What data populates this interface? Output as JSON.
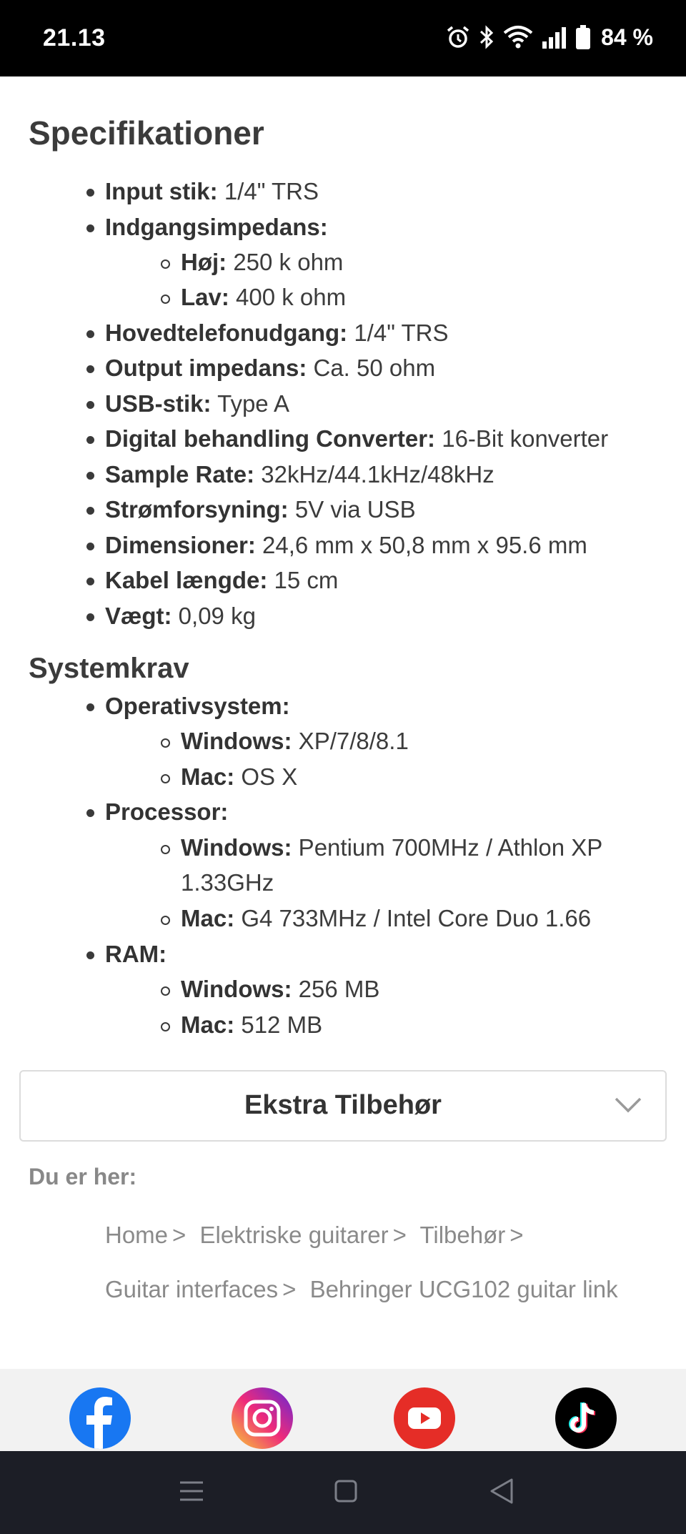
{
  "status_bar": {
    "time": "21.13",
    "battery_percent": "84 %",
    "icons": [
      "alarm-icon",
      "bluetooth-icon",
      "wifi-icon",
      "signal-icon",
      "battery-icon"
    ]
  },
  "specs": {
    "title": "Specifikationer",
    "items": [
      {
        "label": "Input stik:",
        "value": " 1/4\" TRS"
      },
      {
        "label": "Indgangsimpedans:",
        "value": ""
      },
      {
        "label": "Høj:",
        "value": " 250 k ohm"
      },
      {
        "label": "Lav:",
        "value": " 400 k ohm"
      },
      {
        "label": "Hovedtelefonudgang:",
        "value": " 1/4\" TRS"
      },
      {
        "label": "Output impedans:",
        "value": " Ca. 50 ohm"
      },
      {
        "label": "USB-stik:",
        "value": " Type A"
      },
      {
        "label": "Digital behandling Converter:",
        "value": " 16-Bit konverter"
      },
      {
        "label": "Sample Rate:",
        "value": " 32kHz/44.1kHz/48kHz"
      },
      {
        "label": "Strømforsyning:",
        "value": " 5V via USB"
      },
      {
        "label": "Dimensioner:",
        "value": " 24,6 mm x 50,8 mm x 95.6 mm"
      },
      {
        "label": "Kabel længde:",
        "value": " 15 cm"
      },
      {
        "label": "Vægt:",
        "value": " 0,09 kg"
      }
    ]
  },
  "system": {
    "title": "Systemkrav",
    "items": [
      {
        "label": "Operativsystem:",
        "value": ""
      },
      {
        "label": "Windows:",
        "value": " XP/7/8/8.1"
      },
      {
        "label": "Mac:",
        "value": " OS X"
      },
      {
        "label": "Processor:",
        "value": ""
      },
      {
        "label": "Windows:",
        "value": " Pentium 700MHz / Athlon XP"
      },
      {
        "label": "",
        "value": "1.33GHz"
      },
      {
        "label": "Mac:",
        "value": " G4 733MHz / Intel Core Duo 1.66"
      },
      {
        "label": "RAM:",
        "value": ""
      },
      {
        "label": "Windows:",
        "value": " 256 MB"
      },
      {
        "label": "Mac:",
        "value": " 512 MB"
      }
    ]
  },
  "accordion": {
    "label": "Ekstra Tilbehør"
  },
  "breadcrumb": {
    "label": "Du er her:",
    "items": [
      "Home",
      "Elektriske guitarer",
      "Tilbehør",
      "Guitar interfaces",
      "Behringer UCG102 guitar link"
    ],
    "separator": ">"
  },
  "social": [
    "facebook-icon",
    "instagram-icon",
    "youtube-icon",
    "tiktok-icon"
  ],
  "colors": {
    "facebook": "#1877f2",
    "youtube": "#e52d27",
    "tiktok": "#000000"
  }
}
